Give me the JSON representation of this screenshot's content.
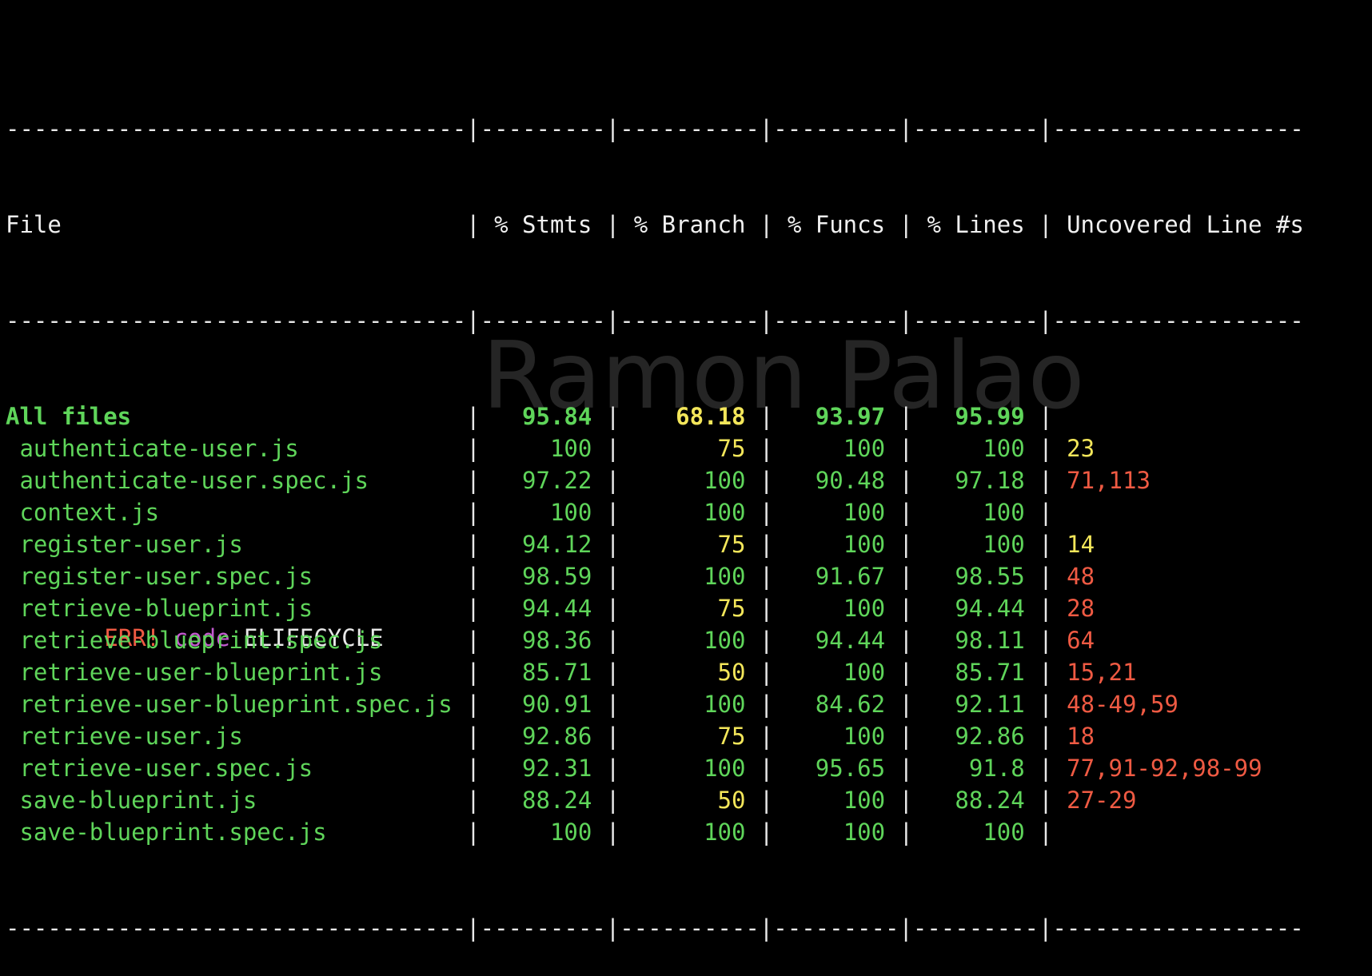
{
  "header": {
    "file": "File",
    "stmts": "% Stmts",
    "branch": "% Branch",
    "funcs": "% Funcs",
    "lines": "% Lines",
    "uncovered": "Uncovered Line #s"
  },
  "summary": {
    "label": "All files",
    "stmts": "95.84",
    "branch": "68.18",
    "funcs": "93.97",
    "lines": "95.99",
    "uncovered": ""
  },
  "files": [
    {
      "name": "authenticate-user.js",
      "stmts": "100",
      "branch": "75",
      "funcs": "100",
      "lines": "100",
      "uncovered": "23"
    },
    {
      "name": "authenticate-user.spec.js",
      "stmts": "97.22",
      "branch": "100",
      "funcs": "90.48",
      "lines": "97.18",
      "uncovered": "71,113"
    },
    {
      "name": "context.js",
      "stmts": "100",
      "branch": "100",
      "funcs": "100",
      "lines": "100",
      "uncovered": ""
    },
    {
      "name": "register-user.js",
      "stmts": "94.12",
      "branch": "75",
      "funcs": "100",
      "lines": "100",
      "uncovered": "14"
    },
    {
      "name": "register-user.spec.js",
      "stmts": "98.59",
      "branch": "100",
      "funcs": "91.67",
      "lines": "98.55",
      "uncovered": "48"
    },
    {
      "name": "retrieve-blueprint.js",
      "stmts": "94.44",
      "branch": "75",
      "funcs": "100",
      "lines": "94.44",
      "uncovered": "28"
    },
    {
      "name": "retrieve-blueprint.spec.js",
      "stmts": "98.36",
      "branch": "100",
      "funcs": "94.44",
      "lines": "98.11",
      "uncovered": "64"
    },
    {
      "name": "retrieve-user-blueprint.js",
      "stmts": "85.71",
      "branch": "50",
      "funcs": "100",
      "lines": "85.71",
      "uncovered": "15,21"
    },
    {
      "name": "retrieve-user-blueprint.spec.js",
      "stmts": "90.91",
      "branch": "100",
      "funcs": "84.62",
      "lines": "92.11",
      "uncovered": "48-49,59"
    },
    {
      "name": "retrieve-user.js",
      "stmts": "92.86",
      "branch": "75",
      "funcs": "100",
      "lines": "92.86",
      "uncovered": "18"
    },
    {
      "name": "retrieve-user.spec.js",
      "stmts": "92.31",
      "branch": "100",
      "funcs": "95.65",
      "lines": "91.8",
      "uncovered": "77,91-92,98-99"
    },
    {
      "name": "save-blueprint.js",
      "stmts": "88.24",
      "branch": "50",
      "funcs": "100",
      "lines": "88.24",
      "uncovered": "27-29"
    },
    {
      "name": "save-blueprint.spec.js",
      "stmts": "100",
      "branch": "100",
      "funcs": "100",
      "lines": "100",
      "uncovered": ""
    }
  ],
  "watermark": "Ramon Palao",
  "tail": {
    "error_word": "ERR!",
    "code_word": "code",
    "code_value": "ELIFECYCLE"
  },
  "colors": {
    "background": "#000000",
    "good": "#5fd55a",
    "medium": "#f3e65a",
    "low": "#ef5a43",
    "text": "#e8e8e8",
    "watermark": "#aaaaaa"
  }
}
